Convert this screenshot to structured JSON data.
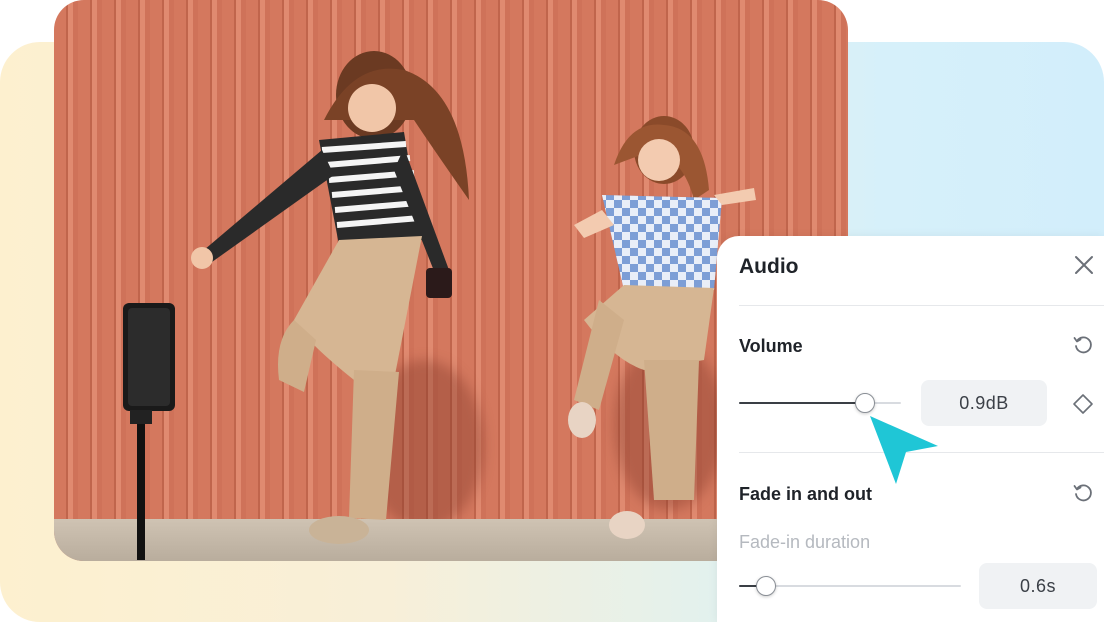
{
  "panel": {
    "title": "Audio",
    "volume": {
      "label": "Volume",
      "value": "0.9dB",
      "slider_position": 0.78
    },
    "fade": {
      "label": "Fade in and out",
      "fade_in_label": "Fade-in duration",
      "fade_in_value": "0.6s",
      "slider_position": 0.12
    }
  },
  "icons": {
    "close": "close-icon",
    "reset": "reset-icon",
    "keyframe": "keyframe-diamond-icon",
    "cursor": "pointer-cursor-icon"
  },
  "colors": {
    "accent_cursor": "#1fc6d6",
    "panel_bg": "#ffffff",
    "text_primary": "#1f2329",
    "text_muted": "#b5b9bf"
  }
}
